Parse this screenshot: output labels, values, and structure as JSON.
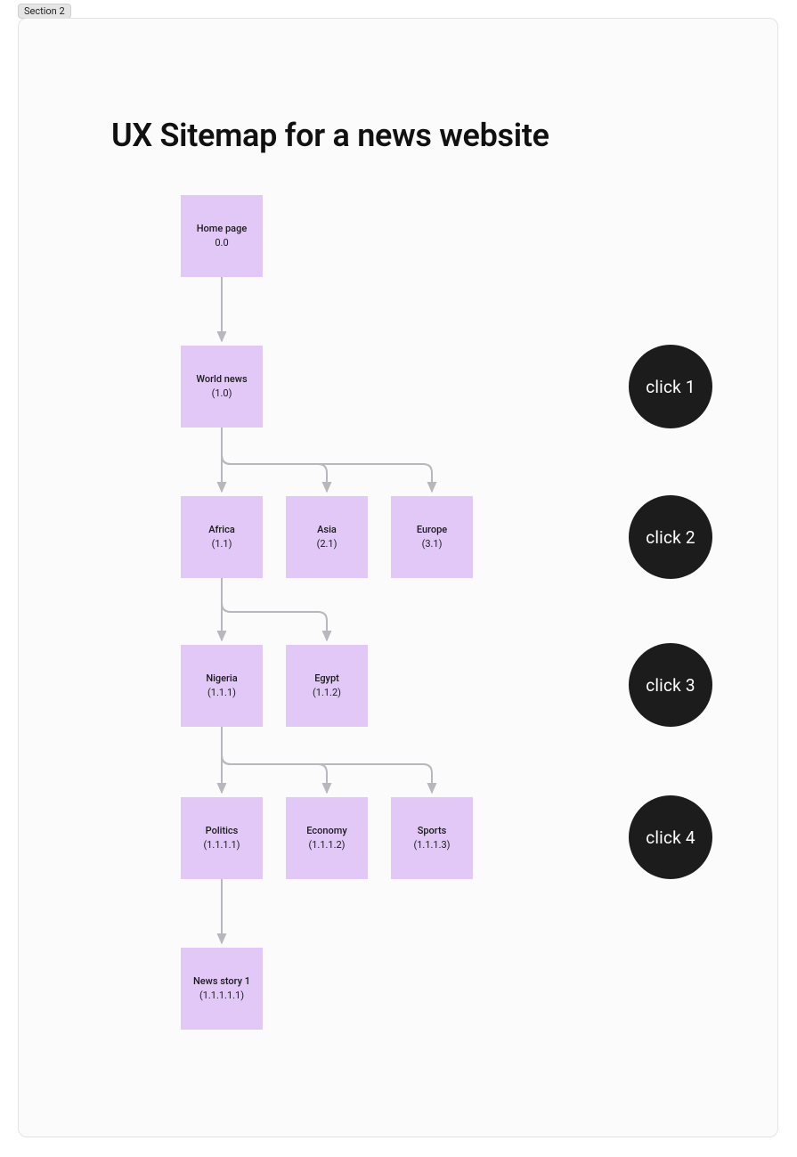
{
  "section_tag": "Section 2",
  "title": "UX Sitemap for a news website",
  "nodes": {
    "home": {
      "label": "Home page",
      "id": "0.0"
    },
    "world": {
      "label": "World news",
      "id": "(1.0)"
    },
    "africa": {
      "label": "Africa",
      "id": "(1.1)"
    },
    "asia": {
      "label": "Asia",
      "id": "(2.1)"
    },
    "europe": {
      "label": "Europe",
      "id": "(3.1)"
    },
    "nigeria": {
      "label": "Nigeria",
      "id": "(1.1.1)"
    },
    "egypt": {
      "label": "Egypt",
      "id": "(1.1.2)"
    },
    "politics": {
      "label": "Politics",
      "id": "(1.1.1.1)"
    },
    "economy": {
      "label": "Economy",
      "id": "(1.1.1.2)"
    },
    "sports": {
      "label": "Sports",
      "id": "(1.1.1.3)"
    },
    "story1": {
      "label": "News story 1",
      "id": "(1.1.1.1.1)"
    }
  },
  "clicks": {
    "c1": "click 1",
    "c2": "click 2",
    "c3": "click 3",
    "c4": "click 4"
  },
  "colors": {
    "node_fill": "#e1c8f7",
    "badge_fill": "#1c1c1c",
    "connector": "#b7b7bd"
  }
}
